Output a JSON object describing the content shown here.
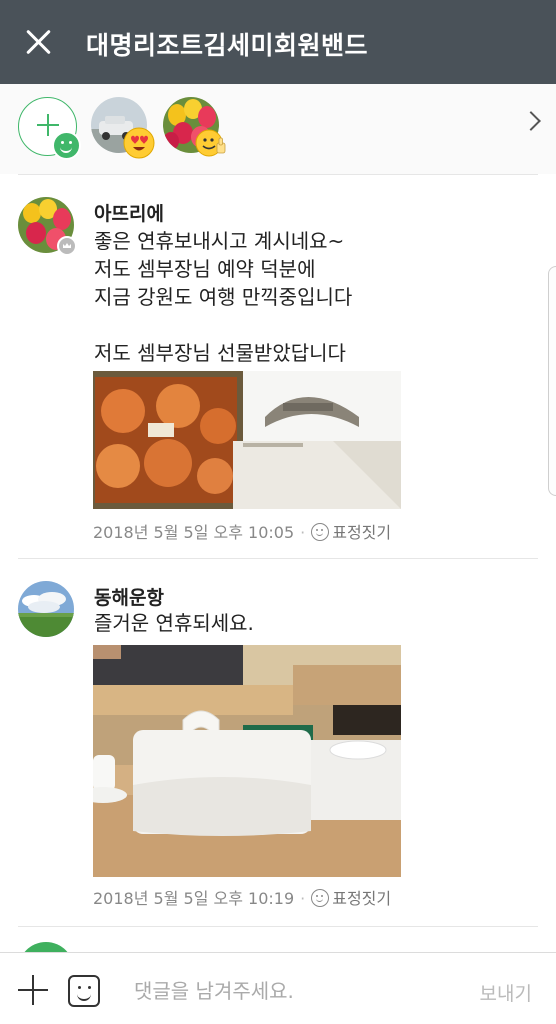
{
  "header": {
    "title": "대명리조트김세미회원밴드",
    "background": "#4a5259"
  },
  "reactions": {
    "accent": "#40b76a",
    "reactors": [
      {
        "emoji": "heart-eyes-emoji-icon"
      },
      {
        "emoji": "thumbs-up-emoji-icon"
      }
    ]
  },
  "comments": [
    {
      "author": "아뜨리에",
      "text": "좋은 연휴보내시고 계시네요~\n저도 셈부장님 예약 덕분에\n지금 강원도 여행 만끽중입니다\n\n저도 셈부장님 선물받았답니다",
      "timestamp": "2018년 5월 5일 오후 10:05",
      "react_label": "표정짓기"
    },
    {
      "author": "동해운항",
      "text": "즐거운 연휴되세요.",
      "timestamp": "2018년 5월 5일 오후 10:19",
      "react_label": "표정짓기"
    }
  ],
  "footer": {
    "placeholder": "댓글을 남겨주세요.",
    "send_label": "보내기"
  }
}
